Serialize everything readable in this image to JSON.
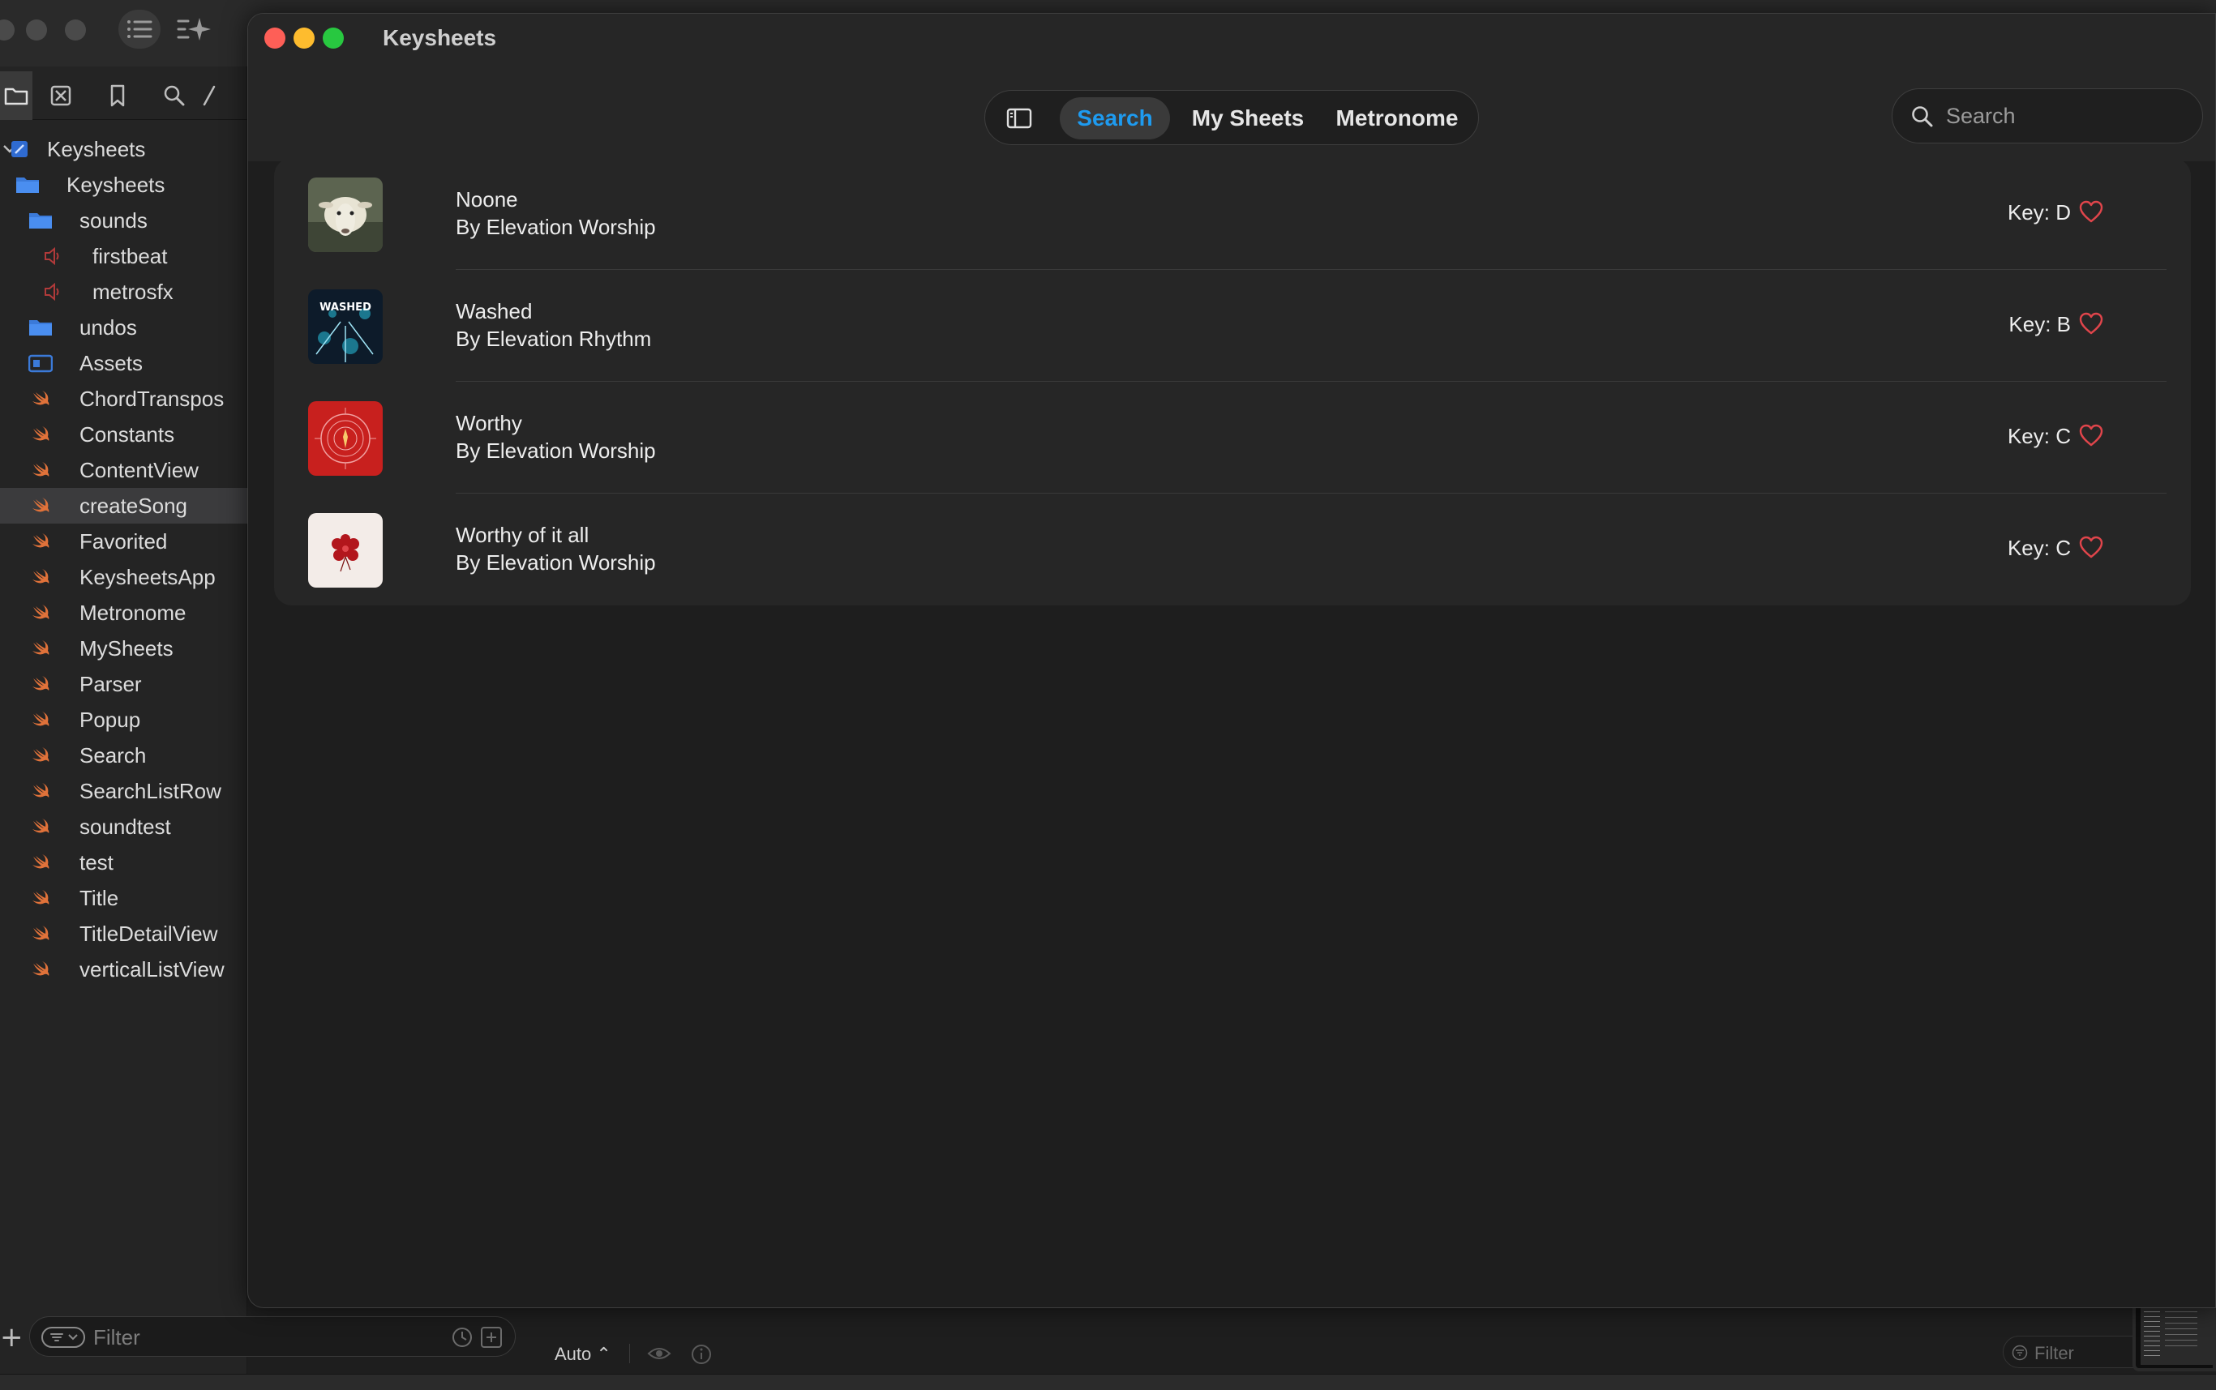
{
  "ide": {
    "sidebar": {
      "items": [
        {
          "label": "Keysheets",
          "indent": 0,
          "kind": "project",
          "disclosure": "open"
        },
        {
          "label": "Keysheets",
          "indent": 1,
          "kind": "folder",
          "disclosure": "open"
        },
        {
          "label": "sounds",
          "indent": 2,
          "kind": "folder",
          "disclosure": "open"
        },
        {
          "label": "firstbeat",
          "indent": 3,
          "kind": "audio",
          "disclosure": "none"
        },
        {
          "label": "metrosfx",
          "indent": 3,
          "kind": "audio",
          "disclosure": "none"
        },
        {
          "label": "undos",
          "indent": 2,
          "kind": "folder",
          "disclosure": "closed"
        },
        {
          "label": "Assets",
          "indent": 2,
          "kind": "assets",
          "disclosure": "none"
        },
        {
          "label": "ChordTranspos",
          "indent": 2,
          "kind": "swift",
          "disclosure": "none"
        },
        {
          "label": "Constants",
          "indent": 2,
          "kind": "swift",
          "disclosure": "none"
        },
        {
          "label": "ContentView",
          "indent": 2,
          "kind": "swift",
          "disclosure": "none"
        },
        {
          "label": "createSong",
          "indent": 2,
          "kind": "swift",
          "disclosure": "none",
          "selected": true
        },
        {
          "label": "Favorited",
          "indent": 2,
          "kind": "swift",
          "disclosure": "none"
        },
        {
          "label": "KeysheetsApp",
          "indent": 2,
          "kind": "swift",
          "disclosure": "none"
        },
        {
          "label": "Metronome",
          "indent": 2,
          "kind": "swift",
          "disclosure": "none"
        },
        {
          "label": "MySheets",
          "indent": 2,
          "kind": "swift",
          "disclosure": "none"
        },
        {
          "label": "Parser",
          "indent": 2,
          "kind": "swift",
          "disclosure": "none"
        },
        {
          "label": "Popup",
          "indent": 2,
          "kind": "swift",
          "disclosure": "none"
        },
        {
          "label": "Search",
          "indent": 2,
          "kind": "swift",
          "disclosure": "none"
        },
        {
          "label": "SearchListRow",
          "indent": 2,
          "kind": "swift",
          "disclosure": "none"
        },
        {
          "label": "soundtest",
          "indent": 2,
          "kind": "swift",
          "disclosure": "none"
        },
        {
          "label": "test",
          "indent": 2,
          "kind": "swift",
          "disclosure": "none"
        },
        {
          "label": "Title",
          "indent": 2,
          "kind": "swift",
          "disclosure": "none"
        },
        {
          "label": "TitleDetailView",
          "indent": 2,
          "kind": "swift",
          "disclosure": "none"
        },
        {
          "label": "verticalListView",
          "indent": 2,
          "kind": "swift",
          "disclosure": "none"
        }
      ],
      "filter_placeholder": "Filter"
    },
    "bottom_bar": {
      "auto_label": "Auto ⌃",
      "filter_placeholder": "Filter"
    }
  },
  "app": {
    "title": "Keysheets",
    "tabs": [
      {
        "label": "Search",
        "active": true
      },
      {
        "label": "My Sheets",
        "active": false
      },
      {
        "label": "Metronome",
        "active": false
      }
    ],
    "search_placeholder": "Search",
    "songs": [
      {
        "title": "Noone",
        "artist": "By Elevation Worship",
        "key": "Key: D",
        "art": "sheep"
      },
      {
        "title": "Washed",
        "artist": "By Elevation Rhythm",
        "key": "Key: B",
        "art": "washed"
      },
      {
        "title": "Worthy",
        "artist": "By Elevation Worship",
        "key": "Key: C",
        "art": "red-emblem"
      },
      {
        "title": "Worthy of it all",
        "artist": "By Elevation Worship",
        "key": "Key: C",
        "art": "red-flower"
      }
    ]
  },
  "colors": {
    "accent": "#1e9bf0",
    "heart": "#e0454b",
    "close": "#fe5f57",
    "minimize": "#febc2e",
    "maximize": "#28c840"
  }
}
